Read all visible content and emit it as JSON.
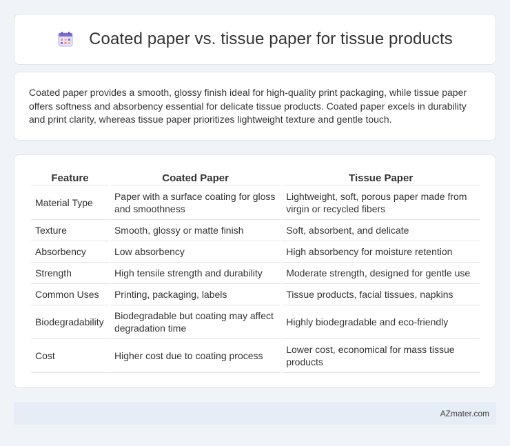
{
  "header": {
    "title": "Coated paper vs. tissue paper for tissue products",
    "icon": "calendar-icon"
  },
  "intro": {
    "text": "Coated paper provides a smooth, glossy finish ideal for high-quality print packaging, while tissue paper offers softness and absorbency essential for delicate tissue products. Coated paper excels in durability and print clarity, whereas tissue paper prioritizes lightweight texture and gentle touch."
  },
  "table": {
    "headers": [
      "Feature",
      "Coated Paper",
      "Tissue Paper"
    ],
    "rows": [
      [
        "Material Type",
        "Paper with a surface coating for gloss and smoothness",
        "Lightweight, soft, porous paper made from virgin or recycled fibers"
      ],
      [
        "Texture",
        "Smooth, glossy or matte finish",
        "Soft, absorbent, and delicate"
      ],
      [
        "Absorbency",
        "Low absorbency",
        "High absorbency for moisture retention"
      ],
      [
        "Strength",
        "High tensile strength and durability",
        "Moderate strength, designed for gentle use"
      ],
      [
        "Common Uses",
        "Printing, packaging, labels",
        "Tissue products, facial tissues, napkins"
      ],
      [
        "Biodegradability",
        "Biodegradable but coating may affect degradation time",
        "Highly biodegradable and eco-friendly"
      ],
      [
        "Cost",
        "Higher cost due to coating process",
        "Lower cost, economical for mass tissue products"
      ]
    ]
  },
  "footer": {
    "site": "AZmater.com"
  },
  "colors": {
    "background": "#f0f3f7",
    "card": "#ffffff",
    "footer": "#e6edf6",
    "icon_accent": "#7b6fd6"
  }
}
